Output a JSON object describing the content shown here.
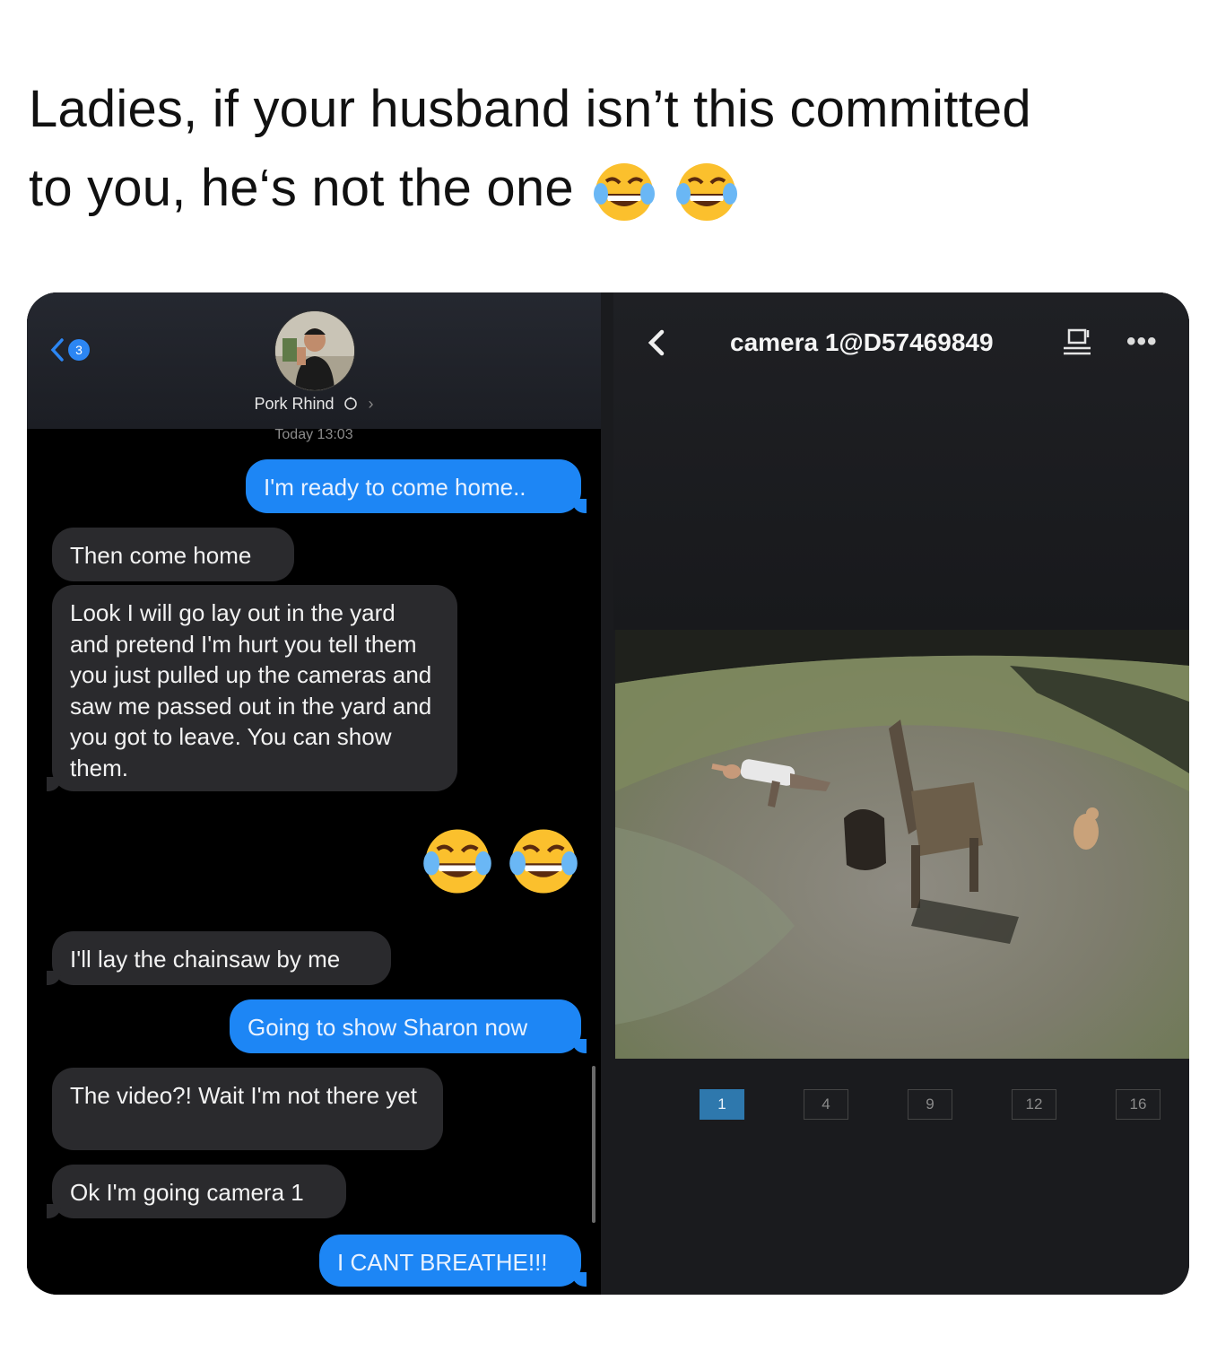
{
  "caption": {
    "line1": "Ladies, if your husband isn’t this committed",
    "line2": "to you, he‘s not the one"
  },
  "messages_app": {
    "unread_count": "3",
    "contact_name": "Pork Rhind",
    "timestamp": "Today 13:03",
    "messages": [
      {
        "dir": "out",
        "text": "I'm ready to come home.."
      },
      {
        "dir": "in",
        "text": "Then come home"
      },
      {
        "dir": "in",
        "text": "Look I will go lay out in the yard and pretend I'm hurt you tell them you just pulled up the cameras and saw me passed out in the yard and you got to leave. You can show them."
      },
      {
        "dir": "out",
        "text": "😂😂",
        "emoji": "face-with-tears-of-joy"
      },
      {
        "dir": "in",
        "text": "I'll lay the chainsaw by me"
      },
      {
        "dir": "out",
        "text": "Going to show Sharon now"
      },
      {
        "dir": "in",
        "text": "The video?! Wait I'm not there yet"
      },
      {
        "dir": "in",
        "text": "Ok I'm going camera 1"
      },
      {
        "dir": "out",
        "text": "I CANT BREATHE!!!"
      }
    ]
  },
  "camera_app": {
    "title": "camera 1@D57469849",
    "grid_options": [
      "1",
      "4",
      "9",
      "12",
      "16"
    ],
    "selected_grid": "1",
    "icons": [
      "back-chevron-icon",
      "screen-icon",
      "more-icon"
    ]
  },
  "colors": {
    "imessage_blue": "#1d86f5",
    "incoming_bubble": "#2a2a2d",
    "camera_selected": "#2e78ad"
  }
}
